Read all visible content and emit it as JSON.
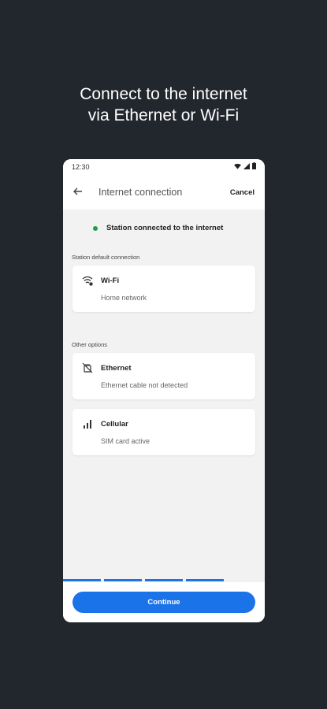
{
  "headline": {
    "line1": "Connect to the internet",
    "line2": "via Ethernet or Wi-Fi"
  },
  "status_bar": {
    "time": "12:30",
    "icons": [
      "wifi-icon",
      "signal-icon",
      "battery-icon"
    ]
  },
  "app_bar": {
    "back_icon": "back-arrow-icon",
    "title": "Internet connection",
    "cancel_label": "Cancel"
  },
  "connection_status": {
    "text": "Station connected to the internet",
    "status_color": "#1e9e4a"
  },
  "default_section": {
    "label": "Station default connection",
    "items": [
      {
        "icon": "wifi-icon",
        "name": "Wi-Fi",
        "detail": "Home network"
      }
    ]
  },
  "other_section": {
    "label": "Other options",
    "items": [
      {
        "icon": "ethernet-icon",
        "name": "Ethernet",
        "detail": "Ethernet cable not detected"
      },
      {
        "icon": "cellular-icon",
        "name": "Cellular",
        "detail": "SIM card active"
      }
    ]
  },
  "progress": {
    "total_steps": 4,
    "completed_steps": 4,
    "active_color": "#1a73e8"
  },
  "footer": {
    "continue_label": "Continue",
    "accent": "#1a73e8"
  }
}
